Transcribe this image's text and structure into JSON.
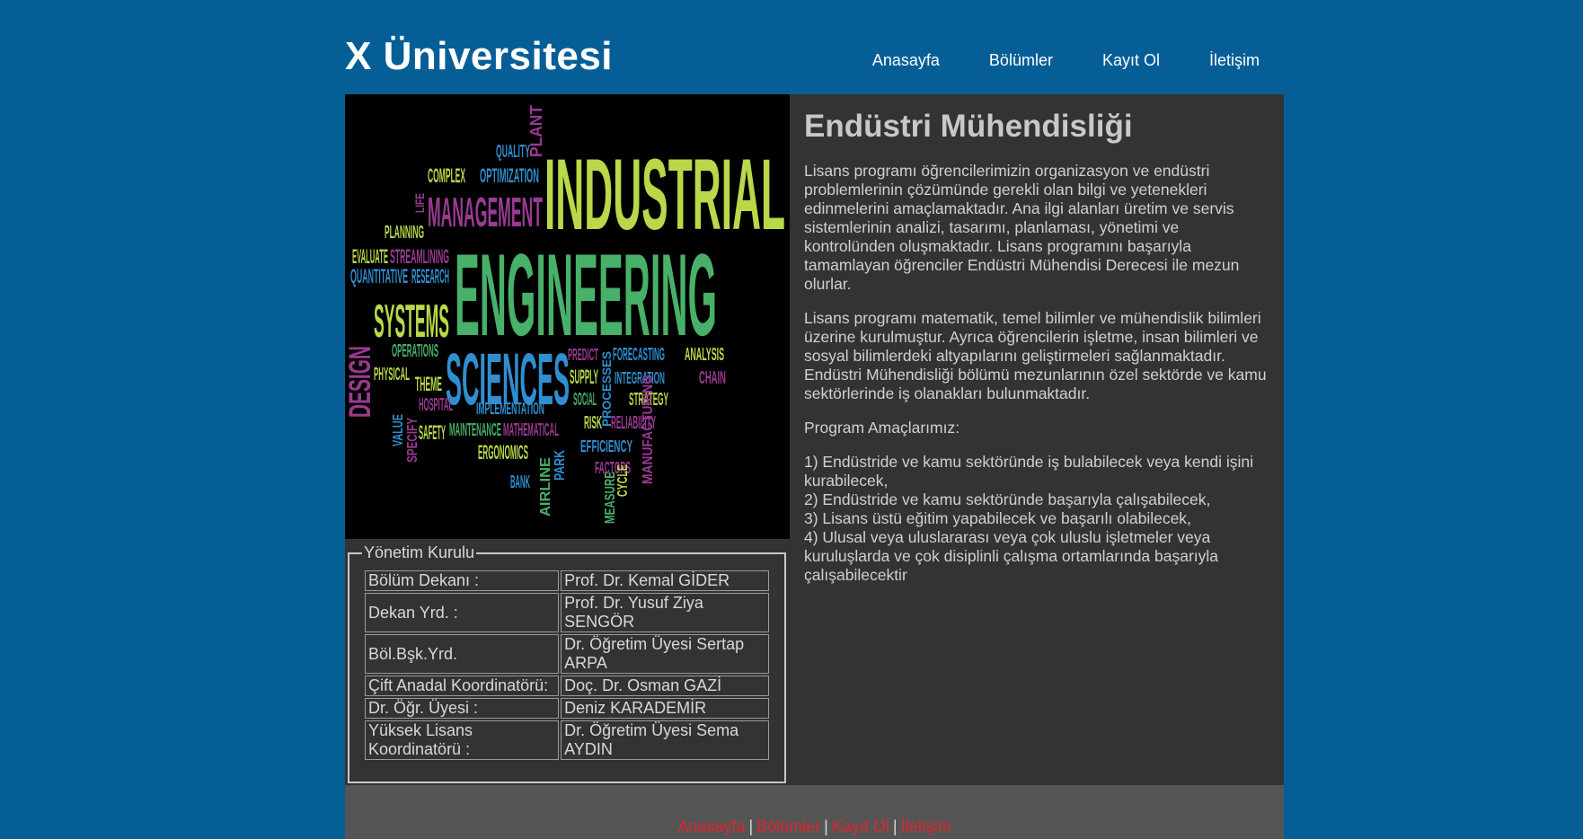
{
  "colors": {
    "page_bg": "#065e96",
    "content_bg": "#333333",
    "footer_bg": "#555555",
    "footer_link": "#e0242e"
  },
  "header": {
    "logo": "X Üniversitesi",
    "nav": [
      "Anasayfa",
      "Bölümler",
      "Kayıt Ol",
      "İletişim"
    ]
  },
  "hero_image": {
    "words": {
      "industrial": "INDUSTRIAL",
      "engineering": "ENGINEERING",
      "sciences": "SCIENCES",
      "management": "MANAGEMENT",
      "systems": "SYSTEMS",
      "design": "DESIGN",
      "quality": "QUALITY",
      "plant": "PLANT",
      "complex": "COMPLEX",
      "optimization": "OPTIMIZATION",
      "life": "LIFE",
      "planning": "PLANNING",
      "evaluate": "EVALUATE",
      "streamlining": "STREAMLINING",
      "quantitative": "QUANTITATIVE",
      "research": "RESEARCH",
      "operations": "OPERATIONS",
      "physical": "PHYSICAL",
      "theme": "THEME",
      "hospital": "HOSPITAL",
      "value": "VALUE",
      "specify": "SPECIFY",
      "safety": "SAFETY",
      "maintenance": "MAINTENANCE",
      "mathematical": "MATHEMATICAL",
      "ergonomics": "ERGONOMICS",
      "bank": "BANK",
      "airline": "AIRLINE",
      "predict": "PREDICT",
      "supply": "SUPPLY",
      "processes": "PROCESSES",
      "forecasting": "FORECASTING",
      "integration": "INTEGRATION",
      "analysis": "ANALYSIS",
      "chain": "CHAIN",
      "manufacturing": "MANUFACTURING",
      "strategy": "STRATEGY",
      "social": "SOCIAL",
      "implementation": "IMPLEMENTATION",
      "risk": "RISK",
      "reliability": "RELIABILITY",
      "efficiency": "EFFICIENCY",
      "park": "PARK",
      "factors": "FACTORS",
      "measure": "MEASURE",
      "cycle": "CYCLE"
    }
  },
  "board": {
    "legend": "Yönetim Kurulu",
    "rows": [
      {
        "role": "Bölüm Dekanı :",
        "name": "Prof. Dr. Kemal GİDER"
      },
      {
        "role": "Dekan Yrd. :",
        "name": "Prof. Dr. Yusuf Ziya SENGÖR"
      },
      {
        "role": "Böl.Bşk.Yrd.",
        "name": "Dr. Öğretim Üyesi Sertap ARPA"
      },
      {
        "role": "Çift Anadal Koordinatörü:",
        "name": "Doç. Dr. Osman GAZİ"
      },
      {
        "role": "Dr. Öğr. Üyesi :",
        "name": "Deniz KARADEMİR"
      },
      {
        "role": "Yüksek Lisans Koordinatörü :",
        "name": "Dr. Öğretim Üyesi Sema AYDIN"
      }
    ]
  },
  "content": {
    "title": "Endüstri Mühendisliği",
    "paragraph1": "Lisans programı öğrencilerimizin organizasyon ve endüstri problemlerinin çözümünde gerekli olan bilgi ve yetenekleri edinmelerini amaçlamaktadır. Ana ilgi alanları üretim ve servis sistemlerinin analizi, tasarımı, planlaması, yönetimi ve kontrolünden oluşmaktadır. Lisans programını başarıyla tamamlayan öğrenciler Endüstri Mühendisi Derecesi ile mezun olurlar.",
    "paragraph2": "Lisans programı matematik, temel bilimler ve mühendislik bilimleri üzerine kurulmuştur. Ayrıca öğrencilerin işletme, insan bilimleri ve sosyal bilimlerdeki altyapılarını geliştirmeleri sağlanmaktadır. Endüstri Mühendisliği bölümü mezunlarının özel sektörde ve kamu sektörlerinde iş olanakları bulunmaktadır.",
    "goals_title": "Program Amaçlarımız:",
    "goals": [
      "1) Endüstride ve kamu sektöründe iş bulabilecek veya kendi işini kurabilecek,",
      "2) Endüstride ve kamu sektöründe başarıyla çalışabilecek,",
      "3) Lisans üstü eğitim yapabilecek ve başarılı olabilecek,",
      "4) Ulusal veya uluslararası veya çok uluslu işletmeler veya kuruluşlarda ve çok disiplinli çalışma ortamlarında başarıyla çalışabilecektir"
    ]
  },
  "footer": {
    "links": [
      "Anasayfa",
      "Bölümler",
      "Kayıt Ol",
      "İletişim"
    ],
    "separator": "|"
  }
}
